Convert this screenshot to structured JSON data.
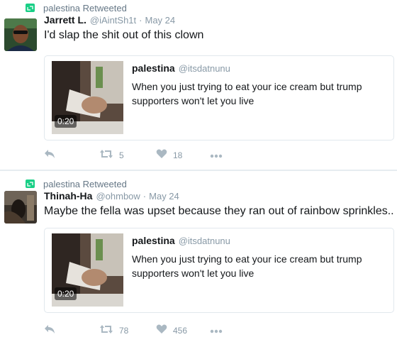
{
  "tweets": [
    {
      "retweeted_by": "palestina Retweeted",
      "name": "Jarrett L.",
      "handle": "@iAintSh1t",
      "dot": "·",
      "time": "May 24",
      "text": "I'd slap the shit out of this clown",
      "quote": {
        "name": "palestina",
        "handle": "@itsdatnunu",
        "text": "When you just trying to eat your ice cream but trump supporters won't let you live",
        "duration": "0:20"
      },
      "retweets": "5",
      "likes": "18"
    },
    {
      "retweeted_by": "palestina Retweeted",
      "name": "Thinah-Ha",
      "handle": "@ohmbow",
      "dot": "·",
      "time": "May 24",
      "text": "Maybe the fella was upset because they ran out of rainbow sprinkles..",
      "quote": {
        "name": "palestina",
        "handle": "@itsdatnunu",
        "text": "When you just trying to eat your ice cream but trump supporters won't let you live",
        "duration": "0:20"
      },
      "retweets": "78",
      "likes": "456"
    }
  ],
  "icons": {
    "retweet_badge": "retweet-icon",
    "reply": "reply-icon",
    "retweet": "retweet-icon",
    "like": "heart-icon",
    "more": "more-icon"
  },
  "colors": {
    "retweet_green": "#19cf86",
    "action_gray": "#8899a6",
    "text": "#14171a"
  }
}
